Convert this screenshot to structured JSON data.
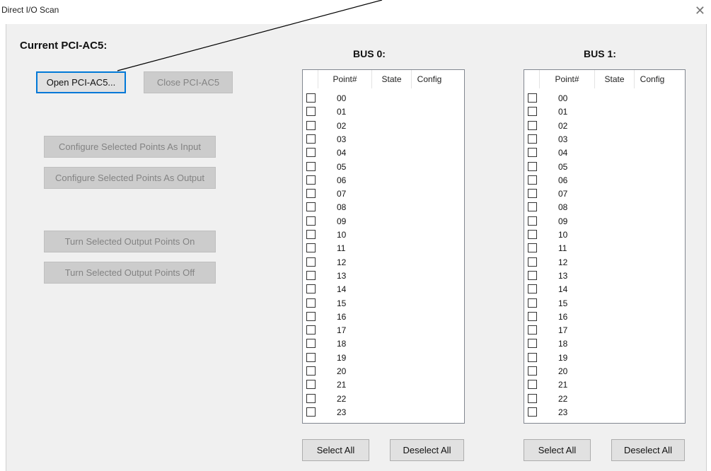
{
  "window": {
    "title": "Direct I/O Scan",
    "close_glyph": "✕"
  },
  "left_panel": {
    "title": "Current PCI-AC5:",
    "open_button": "Open PCI-AC5...",
    "close_button": "Close PCI-AC5",
    "config_input_button": "Configure Selected Points As Input",
    "config_output_button": "Configure Selected Points As Output",
    "turn_on_button": "Turn Selected Output Points On",
    "turn_off_button": "Turn Selected Output Points Off"
  },
  "bus0": {
    "title": "BUS 0:",
    "columns": [
      "Point#",
      "State",
      "Config"
    ],
    "points": [
      "00",
      "01",
      "02",
      "03",
      "04",
      "05",
      "06",
      "07",
      "08",
      "09",
      "10",
      "11",
      "12",
      "13",
      "14",
      "15",
      "16",
      "17",
      "18",
      "19",
      "20",
      "21",
      "22",
      "23"
    ],
    "select_all": "Select All",
    "deselect_all": "Deselect All"
  },
  "bus1": {
    "title": "BUS 1:",
    "columns": [
      "Point#",
      "State",
      "Config"
    ],
    "points": [
      "00",
      "01",
      "02",
      "03",
      "04",
      "05",
      "06",
      "07",
      "08",
      "09",
      "10",
      "11",
      "12",
      "13",
      "14",
      "15",
      "16",
      "17",
      "18",
      "19",
      "20",
      "21",
      "22",
      "23"
    ],
    "select_all": "Select All",
    "deselect_all": "Deselect All"
  },
  "colors": {
    "focus_border": "#0078d7",
    "disabled_bg": "#cccccc",
    "disabled_text": "#838383"
  }
}
